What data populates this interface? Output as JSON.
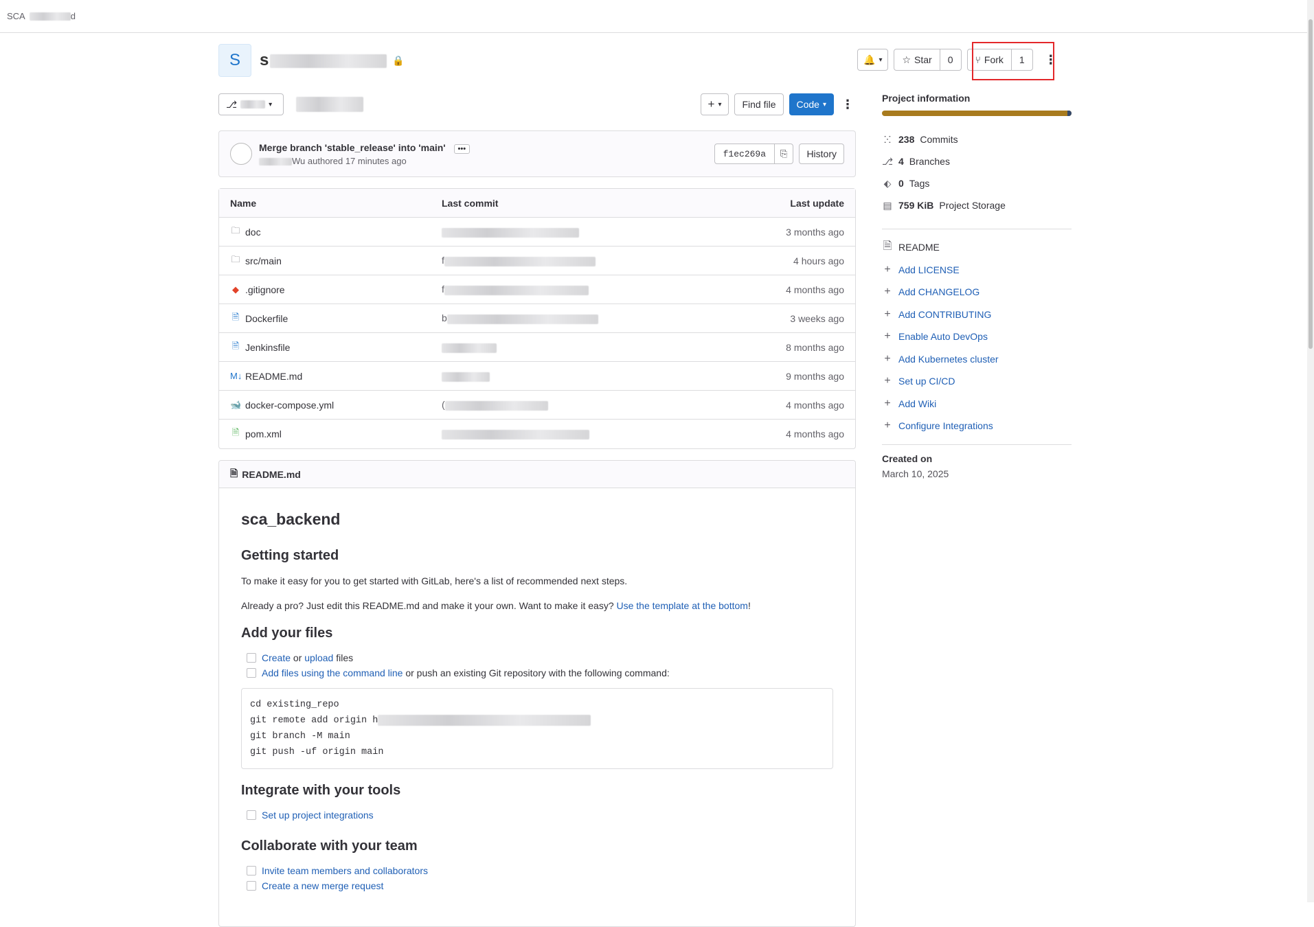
{
  "breadcrumb": "SCA",
  "project": {
    "initial": "S",
    "name_prefix": "s"
  },
  "header_actions": {
    "star_label": "Star",
    "star_count": "0",
    "fork_label": "Fork",
    "fork_count": "1"
  },
  "toolbar": {
    "add_label": "+",
    "find_file_label": "Find file",
    "code_label": "Code"
  },
  "last_commit": {
    "title": "Merge branch 'stable_release' into 'main'",
    "author_suffix": "Wu",
    "authored": "authored 17 minutes ago",
    "sha": "f1ec269a",
    "history_label": "History"
  },
  "files": {
    "headers": {
      "name": "Name",
      "last_commit": "Last commit",
      "last_update": "Last update"
    },
    "rows": [
      {
        "name": "doc",
        "icon": "folder-icon",
        "commit_prefix": "",
        "updated": "3 months ago"
      },
      {
        "name": "src/main",
        "icon": "folder-icon",
        "commit_prefix": "f",
        "updated": "4 hours ago"
      },
      {
        "name": ".gitignore",
        "icon": "git-icon",
        "commit_prefix": "f",
        "updated": "4 months ago"
      },
      {
        "name": "Dockerfile",
        "icon": "file-icon",
        "commit_prefix": "b",
        "updated": "3 weeks ago"
      },
      {
        "name": "Jenkinsfile",
        "icon": "file-icon",
        "commit_prefix": "",
        "updated": "8 months ago"
      },
      {
        "name": "README.md",
        "icon": "markdown-icon",
        "commit_prefix": "",
        "updated": "9 months ago"
      },
      {
        "name": "docker-compose.yml",
        "icon": "docker-icon",
        "commit_prefix": "(",
        "updated": "4 months ago"
      },
      {
        "name": "pom.xml",
        "icon": "xml-icon",
        "commit_prefix": "",
        "updated": "4 months ago"
      }
    ]
  },
  "readme": {
    "file_label": "README.md",
    "title": "sca_backend",
    "getting_started": "Getting started",
    "p1": "To make it easy for you to get started with GitLab, here's a list of recommended next steps.",
    "p2_text": "Already a pro? Just edit this README.md and make it your own. Want to make it easy? ",
    "p2_link": "Use the template at the bottom",
    "p2_end": "!",
    "add_files": "Add your files",
    "task1_link1": "Create",
    "task1_or": " or ",
    "task1_link2": "upload",
    "task1_end": " files",
    "task2_link": "Add files using the command line",
    "task2_end": " or push an existing Git repository with the following command:",
    "code_l1": "cd existing_repo",
    "code_l2": "git remote add origin h",
    "code_l3": "git branch -M main",
    "code_l4": "git push -uf origin main",
    "integrate": "Integrate with your tools",
    "task3_link": "Set up project integrations",
    "collaborate": "Collaborate with your team",
    "task4_link": "Invite team members and collaborators",
    "task5_link": "Create a new merge request"
  },
  "sidebar": {
    "title": "Project information",
    "commits_count": "238",
    "commits_label": "Commits",
    "branches_count": "4",
    "branches_label": "Branches",
    "tags_count": "0",
    "tags_label": "Tags",
    "storage_count": "759 KiB",
    "storage_label": "Project Storage",
    "readme_label": "README",
    "links": [
      "Add LICENSE",
      "Add CHANGELOG",
      "Add CONTRIBUTING",
      "Enable Auto DevOps",
      "Add Kubernetes cluster",
      "Set up CI/CD",
      "Add Wiki",
      "Configure Integrations"
    ],
    "created_label": "Created on",
    "created_date": "March 10, 2025"
  },
  "colors": {
    "primary": "#1f75cb",
    "link": "#1f5fb5",
    "highlight": "#e3272a"
  }
}
